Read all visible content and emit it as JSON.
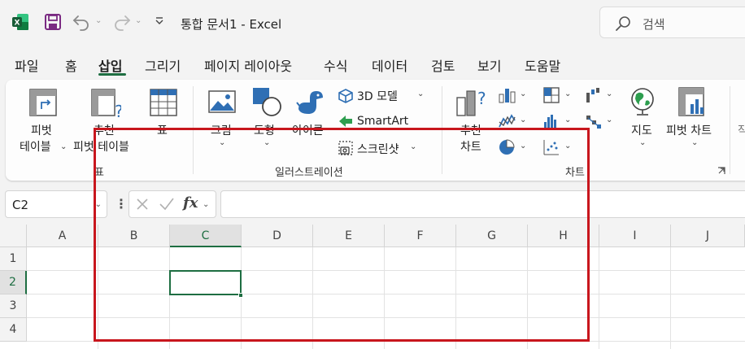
{
  "titlebar": {
    "doc_title": "통합 문서1  -  Excel",
    "search_placeholder": "검색",
    "undo_chevron": "⌄",
    "redo_chevron": "⌄"
  },
  "tabs": [
    {
      "label": "파일"
    },
    {
      "label": "홈"
    },
    {
      "label": "삽입",
      "active": true
    },
    {
      "label": "그리기"
    },
    {
      "label": "페이지 레이아웃"
    },
    {
      "label": "수식"
    },
    {
      "label": "데이터"
    },
    {
      "label": "검토"
    },
    {
      "label": "보기"
    },
    {
      "label": "도움말"
    }
  ],
  "ribbon": {
    "tables": {
      "pivot_line1": "피벗",
      "pivot_line2": "테이블",
      "rec_pivot_line1": "추천",
      "rec_pivot_line2": "피벗 테이블",
      "table": "표",
      "group_label": "표"
    },
    "illustrations": {
      "pictures": "그림",
      "shapes": "도형",
      "icons": "아이콘",
      "model_3d": "3D 모델",
      "smartart": "SmartArt",
      "screenshot": "스크린샷",
      "group_label": "일러스트레이션"
    },
    "charts": {
      "rec_line1": "추천",
      "rec_line2": "차트",
      "maps": "지도",
      "pivot_chart": "피벗 차트",
      "group_label": "차트",
      "cut_label": "작"
    }
  },
  "formula_bar": {
    "name_box": "C2",
    "fx": "fx",
    "formula": ""
  },
  "grid": {
    "columns": [
      "A",
      "B",
      "C",
      "D",
      "E",
      "F",
      "G",
      "H",
      "I",
      "J"
    ],
    "rows": [
      "1",
      "2",
      "3",
      "4"
    ],
    "active_cell": "C2"
  },
  "colors": {
    "excel_green": "#1e6e42",
    "highlight_red": "#c8161d",
    "icon_blue": "#2f6fb4"
  }
}
